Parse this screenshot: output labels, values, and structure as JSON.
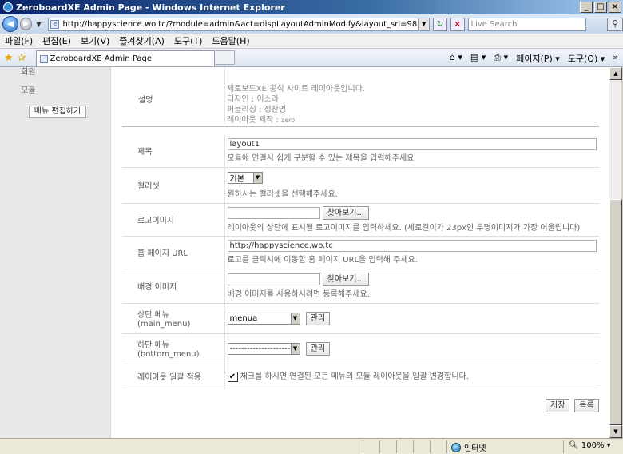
{
  "window": {
    "title": "ZeroboardXE Admin Page - Windows Internet Explorer"
  },
  "address_bar": {
    "url": "http://happyscience.wo.tc/?module=admin&act=dispLayoutAdminModify&layout_srl=98",
    "search_placeholder": "Live Search"
  },
  "menu": [
    "파일(F)",
    "편집(E)",
    "보기(V)",
    "즐겨찾기(A)",
    "도구(T)",
    "도움말(H)"
  ],
  "tab": {
    "title": "ZeroboardXE Admin Page"
  },
  "tab_tools": {
    "page": "페이지(P) ▾",
    "tools": "도구(O) ▾"
  },
  "sidebar": {
    "items": [
      "회원",
      "모듈"
    ],
    "edit_button": "메뉴 편집하기"
  },
  "layout_info": {
    "label": "설명",
    "lines": [
      "제로보드XE 공식 사이트 레이아웃입니다.",
      "디자인 : 이소라",
      "퍼블리싱 : 정찬명"
    ],
    "maker_label": "레이아웃 제작 :",
    "maker": "zero"
  },
  "form": {
    "title": {
      "label": "제목",
      "value": "layout1",
      "help": "모듈에 연결시 쉽게 구분할 수 있는 제목을 입력해주세요"
    },
    "colorset": {
      "label": "컬러셋",
      "selected": "기본",
      "help": "원하시는 컬러셋을 선택해주세요."
    },
    "logo": {
      "label": "로고이미지",
      "value": "",
      "browse": "찾아보기...",
      "help": "레이아웃의 상단에 표시될 로고이미지를 입력하세요. (세로길이가 23px인 투명이미지가 가장 어울립니다)"
    },
    "homepage": {
      "label": "홈 페이지 URL",
      "value": "http://happyscience.wo.tc",
      "help": "로고를 클릭시에 이동할 홈 페이지 URL을 입력해 주세요."
    },
    "bg_image": {
      "label": "배경 이미지",
      "value": "",
      "browse": "찾아보기...",
      "help": "배경 이미지를 사용하시려면 등록해주세요."
    },
    "main_menu": {
      "label": "상단 메뉴",
      "sublabel": "(main_menu)",
      "selected": "menua",
      "manage": "관리"
    },
    "bottom_menu": {
      "label": "하단 메뉴",
      "sublabel": "(bottom_menu)",
      "selected": "------------------------",
      "manage": "관리"
    },
    "apply_all": {
      "label": "레이아웃 일괄 적용",
      "checked": "✔",
      "text": "체크를 하시면 연결된 모든 메뉴의 모듈 레이아웃을 일괄 변경합니다."
    }
  },
  "buttons": {
    "save": "저장",
    "list": "목록"
  },
  "status": {
    "zone": "인터넷",
    "zoom": "100%"
  },
  "colors": {
    "title_bar_start": "#0a246a",
    "title_bar_end": "#a6caf0",
    "sidebar_bg": "#e8e8e8"
  }
}
